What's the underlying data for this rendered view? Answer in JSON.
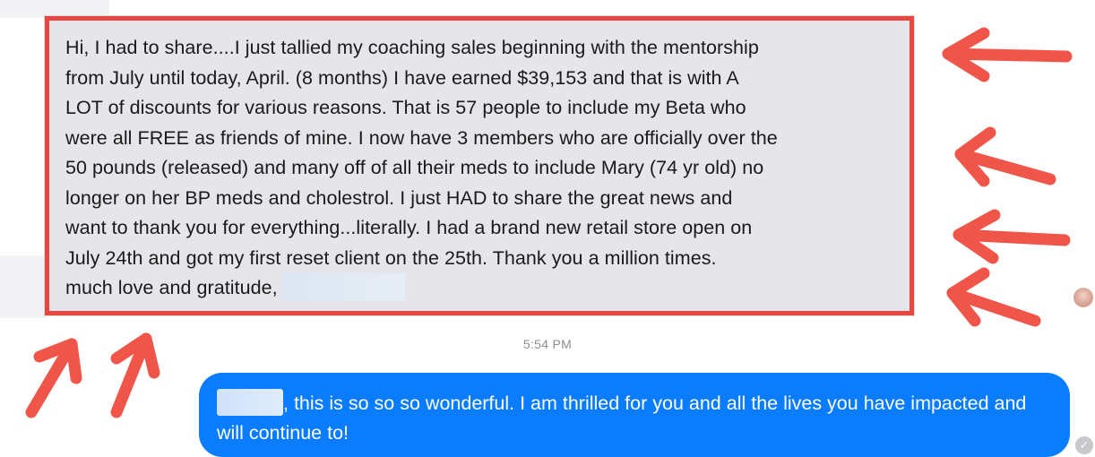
{
  "conversation": {
    "incoming_message": {
      "lines": [
        "Hi, I had to share....I just tallied my coaching sales beginning with the mentorship",
        "from July until today, April. (8 months) I have earned $39,153 and that is with  A",
        "LOT of discounts for various reasons.  That is 57 people to include my Beta who",
        "were all FREE as friends of mine.  I now have 3 members who are officially over the",
        "50 pounds (released) and many off of all their meds to include Mary (74 yr old) no",
        "longer on her BP meds and cholestrol. I just HAD to share the great news and",
        "want to thank you for everything...literally. I had a brand new retail store open on",
        "July 24th and got my first reset client on the 25th. Thank you a million times.",
        "much love and gratitude,"
      ],
      "highlight_color": "#e8473f"
    },
    "timestamp": "5:54 PM",
    "outgoing_message": {
      "text": ", this is so so so wonderful. I am thrilled for you and all the lives you have impacted and will continue to!",
      "bubble_color": "#0a7cff"
    },
    "read_receipt_icon": "check-circle-icon",
    "annotation_arrow_color": "#ef5549"
  }
}
